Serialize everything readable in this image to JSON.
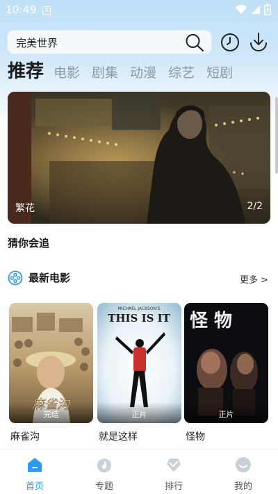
{
  "status_bar": {
    "time": "10:49",
    "notification_glyph": "A"
  },
  "search": {
    "value": "完美世界"
  },
  "tabs": [
    {
      "label": "推荐",
      "active": true
    },
    {
      "label": "电影"
    },
    {
      "label": "剧集"
    },
    {
      "label": "动漫"
    },
    {
      "label": "综艺"
    },
    {
      "label": "短剧"
    }
  ],
  "banner": {
    "caption": "繁花",
    "pager": "2/2"
  },
  "guess_section": {
    "title": "猜你会追"
  },
  "movies_section": {
    "title": "最新电影",
    "more_label": "更多 >",
    "items": [
      {
        "title": "麻雀沟",
        "badge": "完结",
        "poster_text": "麻雀沟"
      },
      {
        "title": "就是这样",
        "badge": "正片",
        "poster_text": "THIS IS IT",
        "poster_sub": "MICHAEL JACKSON'S"
      },
      {
        "title": "怪物",
        "badge": "正片",
        "poster_text": "怪 物"
      }
    ]
  },
  "bottom_nav": [
    {
      "label": "首页",
      "active": true
    },
    {
      "label": "专题"
    },
    {
      "label": "排行"
    },
    {
      "label": "我的"
    }
  ],
  "colors": {
    "accent": "#2d9af1",
    "tab_inactive": "#8c9aa6",
    "header_bg": "#cfe7f8"
  }
}
